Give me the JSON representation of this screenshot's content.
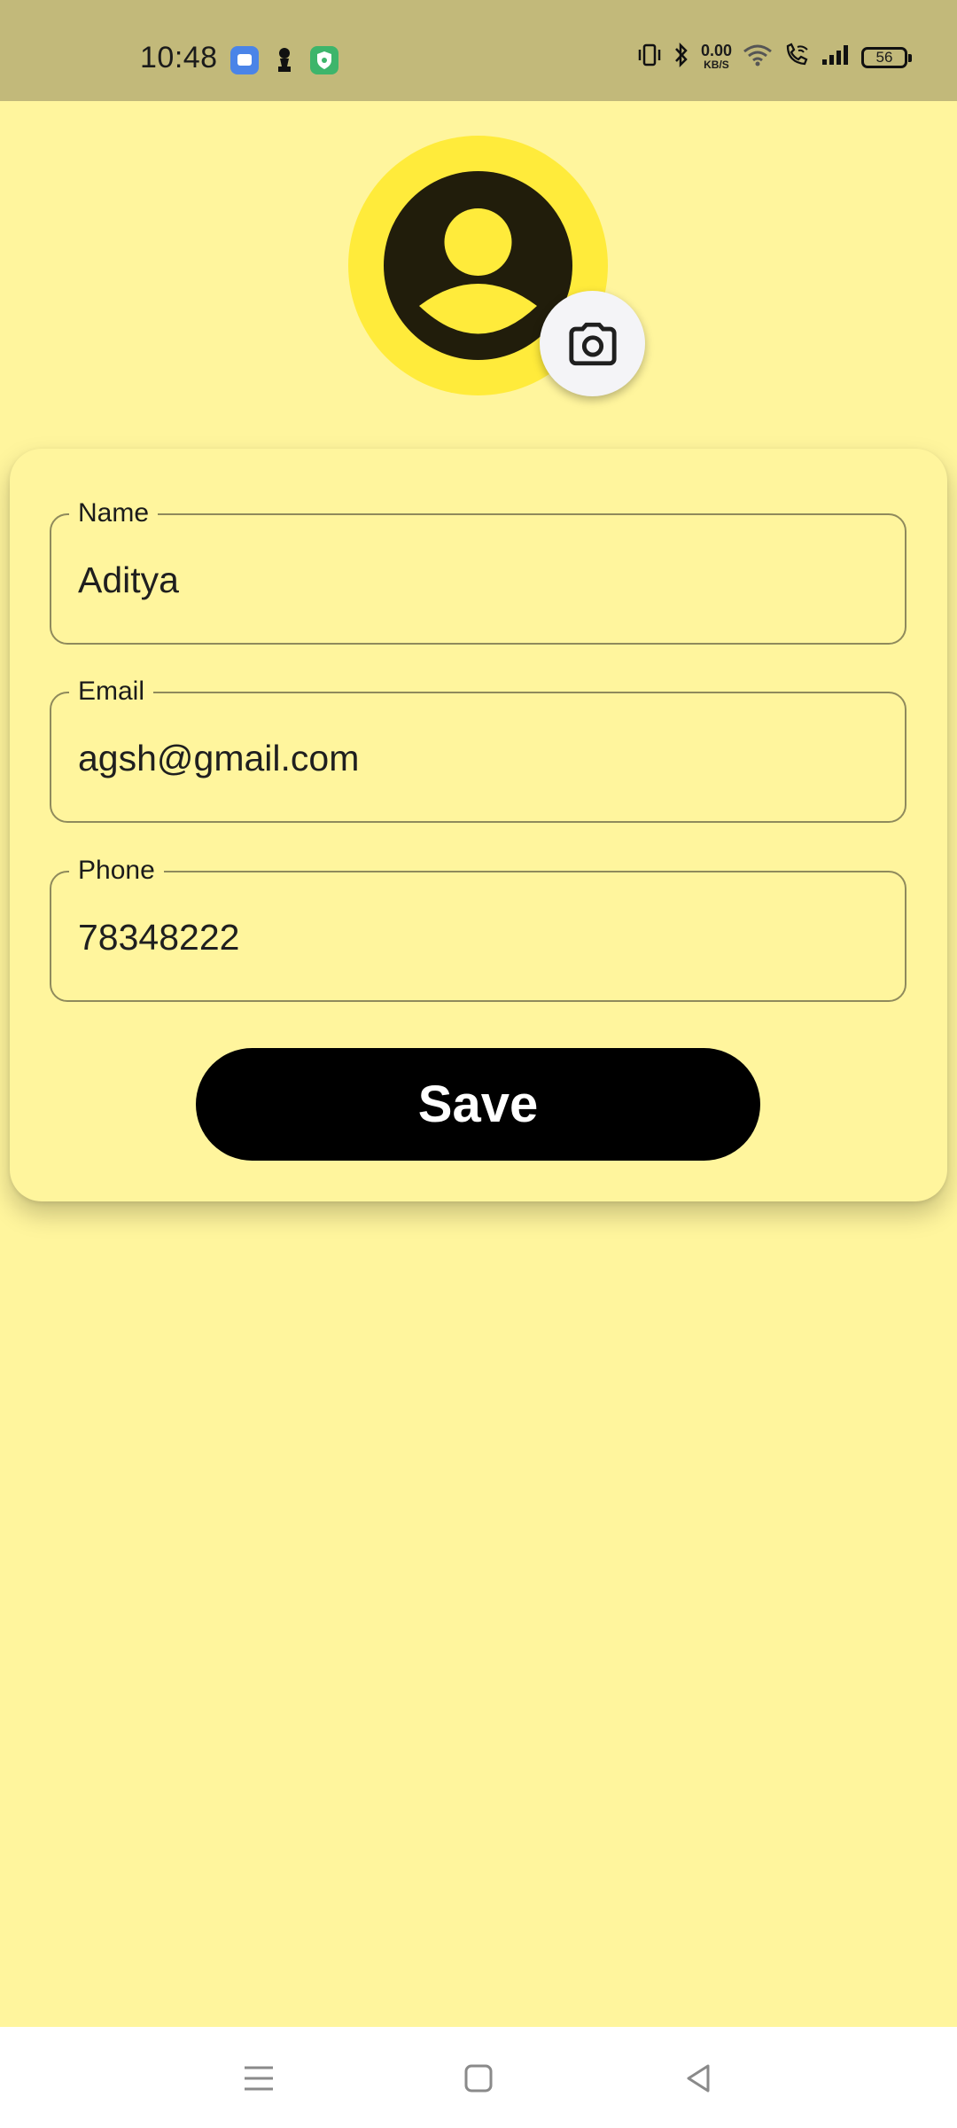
{
  "status_bar": {
    "time": "10:48",
    "net_speed_value": "0.00",
    "net_speed_unit": "KB/S",
    "battery_level": "56",
    "icons": [
      "app-icon-blue",
      "chess-pawn-icon",
      "shield-icon",
      "vibrate-icon",
      "bluetooth-icon",
      "wifi-icon",
      "wifi-call-icon",
      "signal-icon",
      "battery-icon"
    ]
  },
  "profile": {
    "avatar_icon": "account-circle-icon",
    "camera_icon": "camera-icon"
  },
  "form": {
    "fields": [
      {
        "label": "Name",
        "value": "Aditya"
      },
      {
        "label": "Email",
        "value": "agsh@gmail.com"
      },
      {
        "label": "Phone",
        "value": "78348222"
      }
    ],
    "save_label": "Save"
  },
  "nav_bar": {
    "icons": [
      "menu-icon",
      "home-square-icon",
      "back-triangle-icon"
    ]
  },
  "colors": {
    "background": "#FFF59D",
    "status_bar": "#C2B97A",
    "avatar_ring": "#FFEB3B",
    "avatar_icon": "#211D0B",
    "button": "#000000",
    "button_text": "#FFFFFF",
    "field_border": "#8F8A5C"
  }
}
